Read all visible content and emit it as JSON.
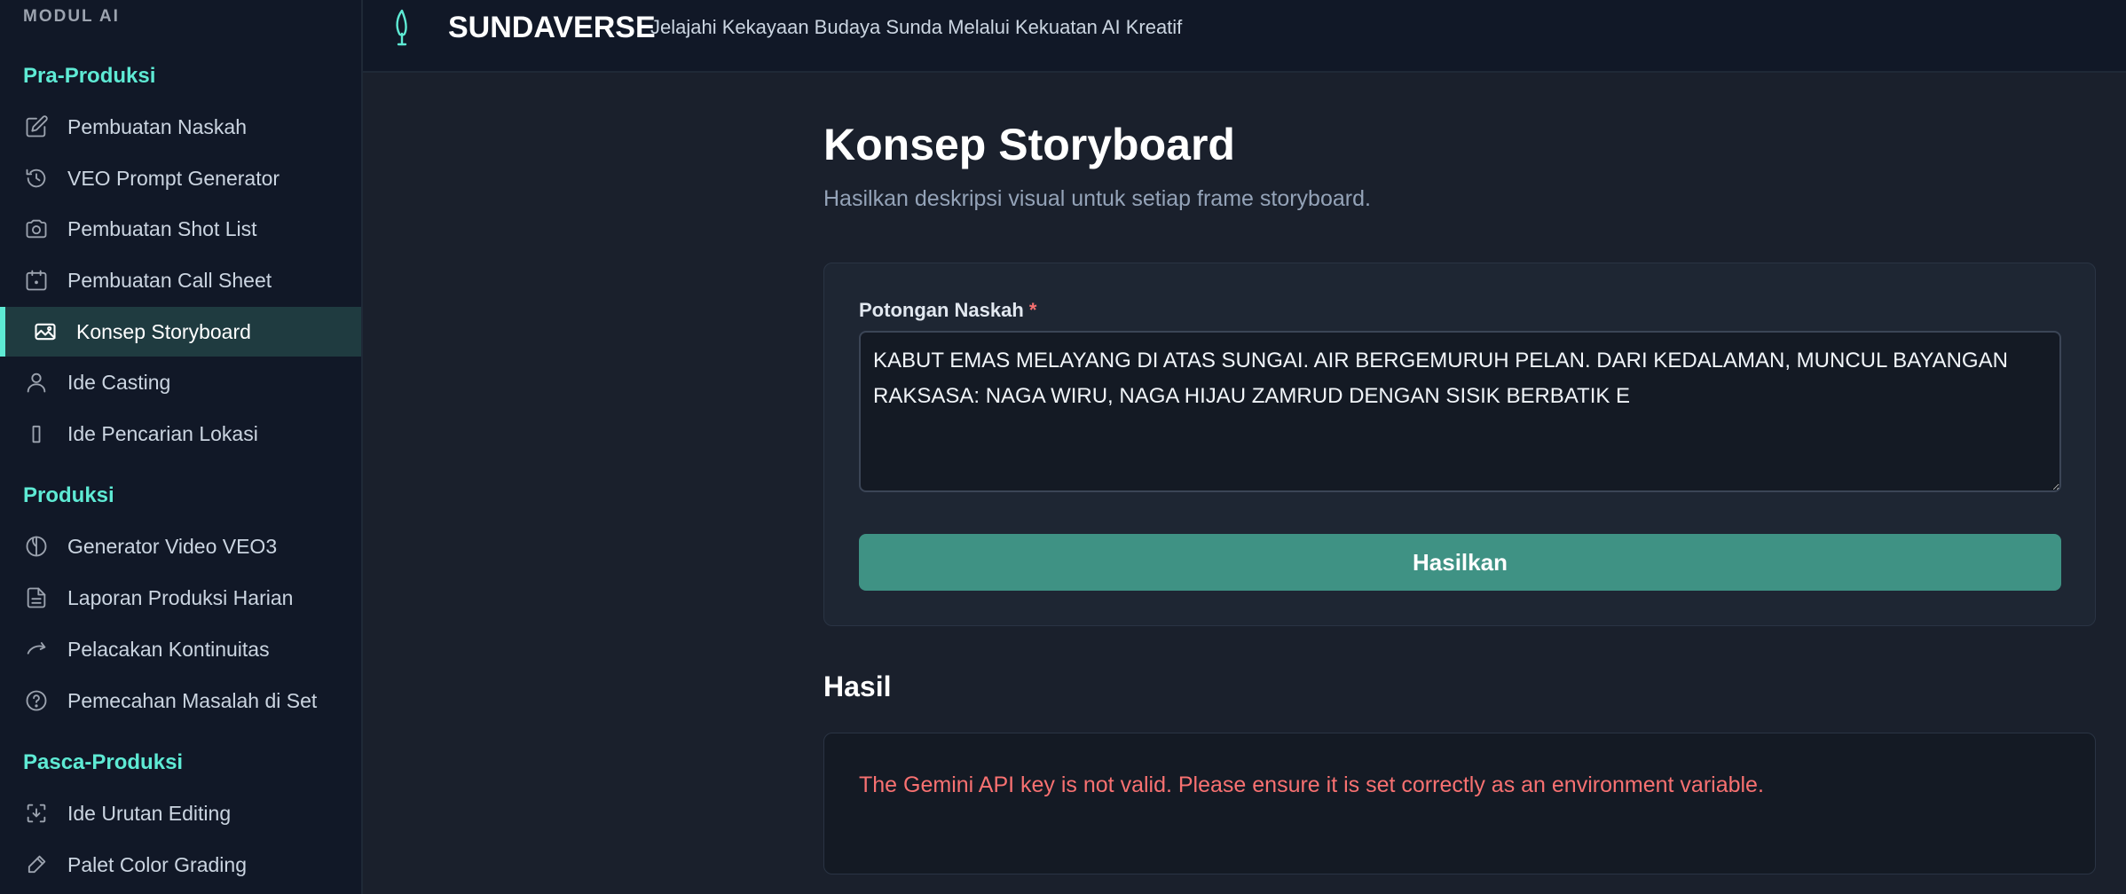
{
  "sidebar": {
    "heading": "MODUL AI",
    "sections": {
      "pre": "Pra-Produksi",
      "prod": "Produksi",
      "post": "Pasca-Produksi"
    },
    "items": [
      {
        "label": "Pembuatan Naskah",
        "icon": "pencil-square-icon"
      },
      {
        "label": "VEO Prompt Generator",
        "icon": "sparkle-cycle-icon"
      },
      {
        "label": "Pembuatan Shot List",
        "icon": "camera-icon"
      },
      {
        "label": "Pembuatan Call Sheet",
        "icon": "calendar-icon"
      },
      {
        "label": "Konsep Storyboard",
        "icon": "image-icon",
        "active": true
      },
      {
        "label": "Ide Casting",
        "icon": "user-icon"
      },
      {
        "label": "Ide Pencarian Lokasi",
        "icon": "location-icon"
      },
      {
        "label": "Generator Video VEO3",
        "icon": "aperture-icon"
      },
      {
        "label": "Laporan Produksi Harian",
        "icon": "document-icon"
      },
      {
        "label": "Pelacakan Kontinuitas",
        "icon": "return-arrow-icon"
      },
      {
        "label": "Pemecahan Masalah di Set",
        "icon": "question-circle-icon"
      },
      {
        "label": "Ide Urutan Editing",
        "icon": "download-frame-icon"
      },
      {
        "label": "Palet Color Grading",
        "icon": "eyedropper-icon"
      }
    ]
  },
  "header": {
    "brand": "SUNDAVERSE",
    "tagline": "Jelajahi Kekayaan Budaya Sunda Melalui Kekuatan AI Kreatif",
    "logo_icon": "kujang-icon"
  },
  "main": {
    "title": "Konsep Storyboard",
    "subtitle": "Hasilkan deskripsi visual untuk setiap frame storyboard.",
    "form": {
      "label": "Potongan Naskah",
      "required_mark": "*",
      "value": "KABUT EMAS MELAYANG DI ATAS SUNGAI. AIR BERGEMURUH PELAN. DARI KEDALAMAN, MUNCUL BAYANGAN RAKSASA: NAGA WIRU, NAGA HIJAU ZAMRUD DENGAN SISIK BERBATIK E",
      "submit_label": "Hasilkan"
    },
    "result": {
      "title": "Hasil",
      "error": "The Gemini API key is not valid. Please ensure it is set correctly as an environment variable."
    }
  },
  "colors": {
    "accent": "#5eead4",
    "button": "#3f9284",
    "error": "#f87171",
    "background": "#1a202c",
    "sidebar": "#111827"
  }
}
